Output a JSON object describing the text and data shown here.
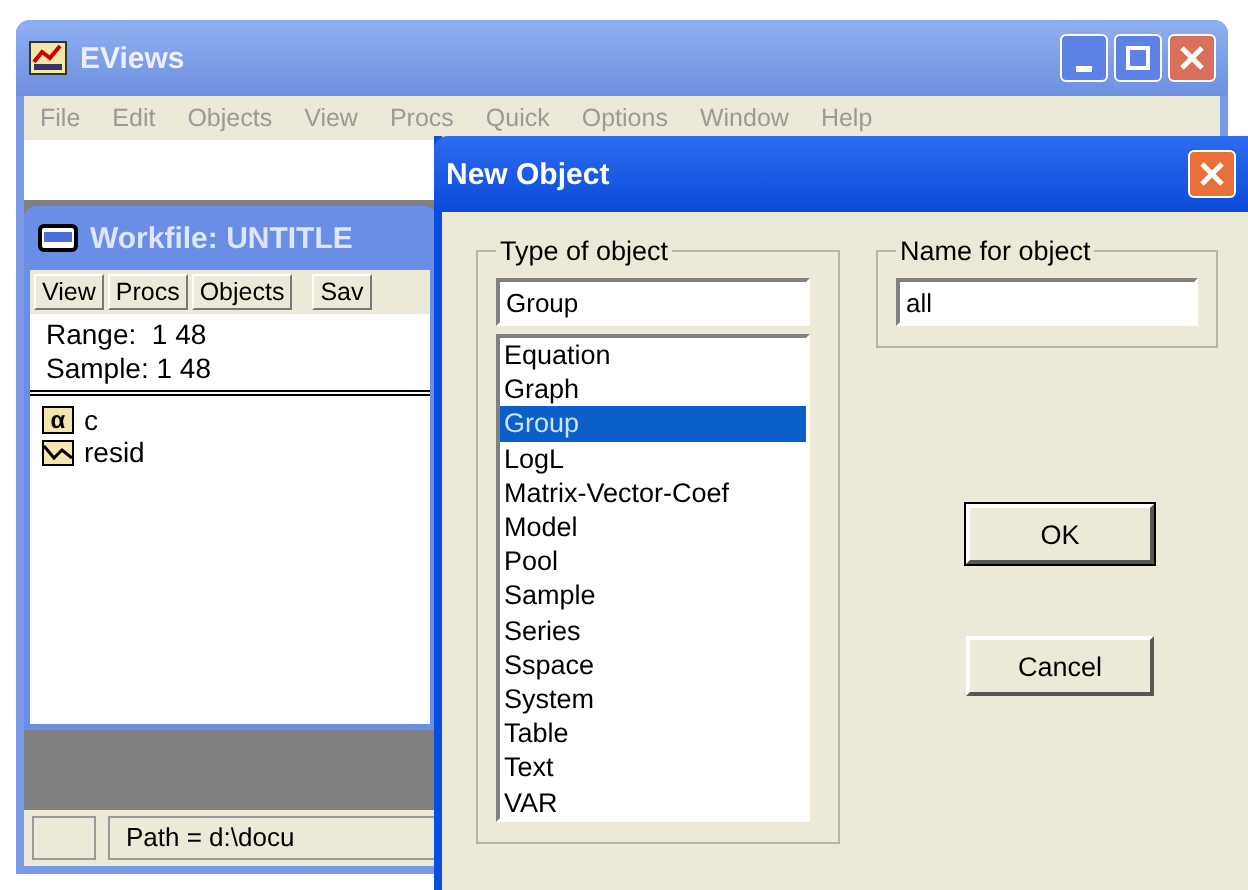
{
  "main_window": {
    "title": "EViews",
    "menu": [
      "File",
      "Edit",
      "Objects",
      "View",
      "Procs",
      "Quick",
      "Options",
      "Window",
      "Help"
    ]
  },
  "workfile_window": {
    "title": "Workfile: UNTITLE",
    "toolbar": [
      "View",
      "Procs",
      "Objects",
      "Sav"
    ],
    "range": "Range:  1 48",
    "sample": "Sample: 1 48",
    "objects": [
      {
        "kind": "coef",
        "icon_text": "α",
        "name": "c"
      },
      {
        "kind": "series",
        "name": "resid"
      }
    ]
  },
  "status_bar": {
    "path": "Path = d:\\docu"
  },
  "dialog": {
    "title": "New Object",
    "type_group": {
      "label": "Type of object",
      "value": "Group",
      "items": [
        {
          "label": "Equation",
          "selected": false
        },
        {
          "label": "Graph",
          "selected": false
        },
        {
          "label": "Group",
          "selected": true
        },
        {
          "label": "LogL",
          "selected": false
        },
        {
          "label": "Matrix-Vector-Coef",
          "selected": false
        },
        {
          "label": "Model",
          "selected": false
        },
        {
          "label": "Pool",
          "selected": false
        },
        {
          "label": "Sample",
          "selected": false
        },
        {
          "label": "Series",
          "selected": false
        },
        {
          "label": "Sspace",
          "selected": false
        },
        {
          "label": "System",
          "selected": false
        },
        {
          "label": "Table",
          "selected": false
        },
        {
          "label": "Text",
          "selected": false
        },
        {
          "label": "VAR",
          "selected": false
        }
      ]
    },
    "name_group": {
      "label": "Name for object",
      "value": "all"
    },
    "buttons": [
      "OK",
      "Cancel"
    ]
  }
}
